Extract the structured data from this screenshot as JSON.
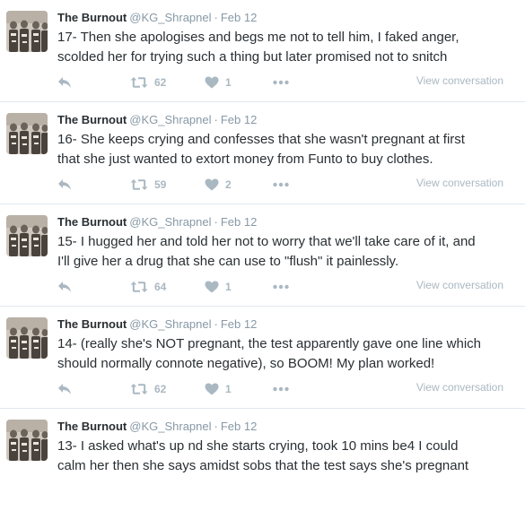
{
  "tweets": [
    {
      "name": "The Burnout",
      "handle": "@KG_Shrapnel",
      "separator": "·",
      "date": "Feb 12",
      "lines": [
        "17- Then she apologises and begs me not to tell him, I faked anger,",
        "scolded her for trying such a thing but later promised not to snitch"
      ],
      "retweets": "62",
      "likes": "1",
      "view_conversation": "View conversation"
    },
    {
      "name": "The Burnout",
      "handle": "@KG_Shrapnel",
      "separator": "·",
      "date": "Feb 12",
      "lines": [
        "16- She keeps crying and confesses that she wasn't pregnant at first",
        "that she just wanted to extort money from Funto to buy clothes."
      ],
      "retweets": "59",
      "likes": "2",
      "view_conversation": "View conversation"
    },
    {
      "name": "The Burnout",
      "handle": "@KG_Shrapnel",
      "separator": "·",
      "date": "Feb 12",
      "lines": [
        "15- I hugged her and told her not to worry that we'll take care of it, and",
        "I'll give her a drug that she can use to \"flush\" it painlessly."
      ],
      "retweets": "64",
      "likes": "1",
      "view_conversation": "View conversation"
    },
    {
      "name": "The Burnout",
      "handle": "@KG_Shrapnel",
      "separator": "·",
      "date": "Feb 12",
      "lines": [
        "14- (really she's NOT pregnant, the test apparently gave one line which",
        "should normally connote negative), so BOOM! My plan worked!"
      ],
      "retweets": "62",
      "likes": "1",
      "view_conversation": "View conversation"
    },
    {
      "name": "The Burnout",
      "handle": "@KG_Shrapnel",
      "separator": "·",
      "date": "Feb 12",
      "lines": [
        "13- I asked what's up nd she starts crying, took 10 mins be4 I could",
        "calm her then she says amidst sobs that the test says she's pregnant"
      ]
    }
  ],
  "icons": {
    "reply": "reply-icon",
    "retweet": "retweet-icon",
    "like": "heart-icon",
    "more": "more-dots-icon"
  },
  "colors": {
    "text": "#292f33",
    "muted": "#8899a6",
    "action": "#aab8c2",
    "divider": "#e1e8ed"
  }
}
